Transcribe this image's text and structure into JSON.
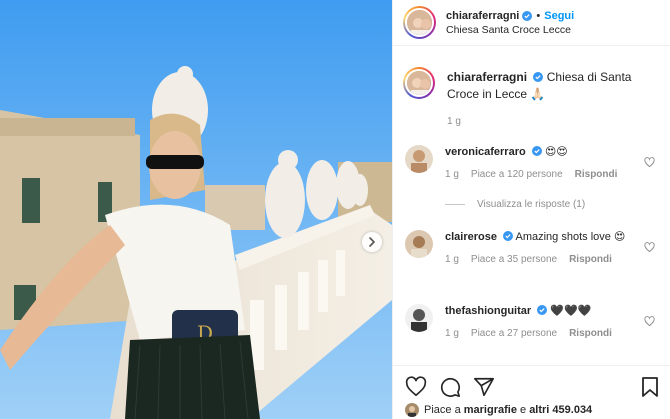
{
  "post": {
    "username": "chiaraferragni",
    "follow_label": "Segui",
    "dot": "•",
    "location": "Chiesa Santa Croce Lecce"
  },
  "caption": {
    "username": "chiaraferragni",
    "text": "Chiesa di Santa Croce in Lecce 🙏🏻",
    "time": "1 g"
  },
  "comments": [
    {
      "username": "veronicaferraro",
      "text": "😍😍",
      "time": "1 g",
      "likes": "Piace a 120 persone",
      "reply": "Rispondi"
    },
    {
      "username": "clairerose",
      "text": "Amazing shots love 😍",
      "time": "1 g",
      "likes": "Piace a 35 persone",
      "reply": "Rispondi"
    },
    {
      "username": "thefashionguitar",
      "text": "🖤🖤🖤",
      "time": "1 g",
      "likes": "Piace a 27 persone",
      "reply": "Rispondi"
    }
  ],
  "view_replies": "Visualizza le risposte (1)",
  "likes_summary": {
    "prefix": "Piace a ",
    "user": "marigrafie",
    "middle": " e ",
    "others": "altri 459.034"
  },
  "colors": {
    "accent": "#0095f6",
    "verified": "#3897f0",
    "muted": "#8e8e8e"
  },
  "icons": [
    "verified-badge-icon",
    "heart-icon",
    "comment-icon",
    "share-icon",
    "bookmark-icon",
    "chevron-right-icon"
  ]
}
